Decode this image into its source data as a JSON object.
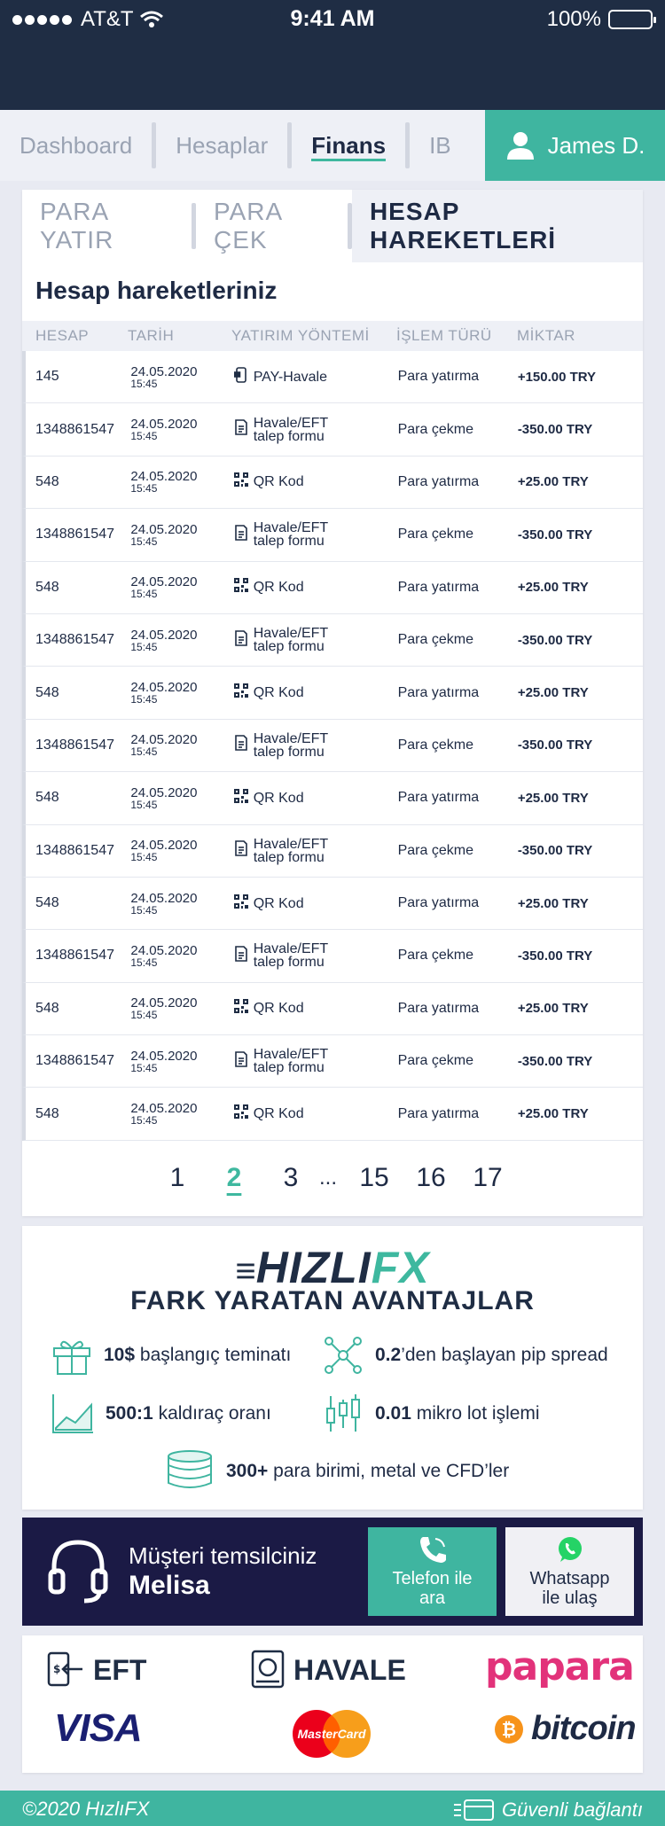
{
  "status": {
    "carrier": "AT&T",
    "time": "9:41 AM",
    "battery": "100%"
  },
  "nav": {
    "tabs": [
      {
        "label": "Dashboard"
      },
      {
        "label": "Hesaplar"
      },
      {
        "label": "Finans",
        "active": true
      },
      {
        "label": "IB"
      }
    ],
    "user": "James D."
  },
  "subtabs": [
    "PARA YATIR",
    "PARA ÇEK",
    "HESAP HAREKETLERİ"
  ],
  "transactions": {
    "title": "Hesap hareketleriniz",
    "headers": [
      "HESAP",
      "TARİH",
      "YATIRIM YÖNTEMİ",
      "İŞLEM TÜRÜ",
      "MİKTAR"
    ],
    "rows": [
      {
        "account": "145",
        "date": "24.05.2020",
        "time": "15:45",
        "method": "PAY-Havale",
        "method2": "",
        "icon": "mobile-pay-icon",
        "type": "Para yatırma",
        "amount": "+150.00 TRY"
      },
      {
        "account": "1348861547",
        "date": "24.05.2020",
        "time": "15:45",
        "method": "Havale/EFT",
        "method2": "talep formu",
        "icon": "form-icon",
        "type": "Para çekme",
        "amount": "-350.00 TRY"
      },
      {
        "account": "548",
        "date": "24.05.2020",
        "time": "15:45",
        "method": "QR Kod",
        "method2": "",
        "icon": "qr-code-icon",
        "type": "Para yatırma",
        "amount": "+25.00 TRY"
      },
      {
        "account": "1348861547",
        "date": "24.05.2020",
        "time": "15:45",
        "method": "Havale/EFT",
        "method2": "talep formu",
        "icon": "form-icon",
        "type": "Para çekme",
        "amount": "-350.00 TRY"
      },
      {
        "account": "548",
        "date": "24.05.2020",
        "time": "15:45",
        "method": "QR Kod",
        "method2": "",
        "icon": "qr-code-icon",
        "type": "Para yatırma",
        "amount": "+25.00 TRY"
      },
      {
        "account": "1348861547",
        "date": "24.05.2020",
        "time": "15:45",
        "method": "Havale/EFT",
        "method2": "talep formu",
        "icon": "form-icon",
        "type": "Para çekme",
        "amount": "-350.00 TRY"
      },
      {
        "account": "548",
        "date": "24.05.2020",
        "time": "15:45",
        "method": "QR Kod",
        "method2": "",
        "icon": "qr-code-icon",
        "type": "Para yatırma",
        "amount": "+25.00 TRY"
      },
      {
        "account": "1348861547",
        "date": "24.05.2020",
        "time": "15:45",
        "method": "Havale/EFT",
        "method2": "talep formu",
        "icon": "form-icon",
        "type": "Para çekme",
        "amount": "-350.00 TRY"
      },
      {
        "account": "548",
        "date": "24.05.2020",
        "time": "15:45",
        "method": "QR Kod",
        "method2": "",
        "icon": "qr-code-icon",
        "type": "Para yatırma",
        "amount": "+25.00 TRY"
      },
      {
        "account": "1348861547",
        "date": "24.05.2020",
        "time": "15:45",
        "method": "Havale/EFT",
        "method2": "talep formu",
        "icon": "form-icon",
        "type": "Para çekme",
        "amount": "-350.00 TRY"
      },
      {
        "account": "548",
        "date": "24.05.2020",
        "time": "15:45",
        "method": "QR Kod",
        "method2": "",
        "icon": "qr-code-icon",
        "type": "Para yatırma",
        "amount": "+25.00 TRY"
      },
      {
        "account": "1348861547",
        "date": "24.05.2020",
        "time": "15:45",
        "method": "Havale/EFT",
        "method2": "talep formu",
        "icon": "form-icon",
        "type": "Para çekme",
        "amount": "-350.00 TRY"
      },
      {
        "account": "548",
        "date": "24.05.2020",
        "time": "15:45",
        "method": "QR Kod",
        "method2": "",
        "icon": "qr-code-icon",
        "type": "Para yatırma",
        "amount": "+25.00 TRY"
      },
      {
        "account": "1348861547",
        "date": "24.05.2020",
        "time": "15:45",
        "method": "Havale/EFT",
        "method2": "talep formu",
        "icon": "form-icon",
        "type": "Para çekme",
        "amount": "-350.00 TRY"
      },
      {
        "account": "548",
        "date": "24.05.2020",
        "time": "15:45",
        "method": "QR Kod",
        "method2": "",
        "icon": "qr-code-icon",
        "type": "Para yatırma",
        "amount": "+25.00 TRY"
      }
    ]
  },
  "pagination": [
    "1",
    "2",
    "3",
    "...",
    "15",
    "16",
    "17"
  ],
  "pagination_active": "2",
  "advantages": {
    "logo_left": "HIZLI",
    "logo_right": "FX",
    "title": "FARK YARATAN AVANTAJLAR",
    "items": [
      {
        "bold": "10$",
        "text": "başlangıç teminatı"
      },
      {
        "bold": "0.2",
        "text": "’den başlayan pip spread"
      },
      {
        "bold": "500:1",
        "text": "kaldıraç oranı"
      },
      {
        "bold": "0.01",
        "text": "mikro lot işlemi"
      },
      {
        "bold": "300+",
        "text": "para birimi, metal ve CFD’ler"
      }
    ]
  },
  "support": {
    "label": "Müşteri temsilciniz",
    "name": "Melisa",
    "call_label_1": "Telefon ile",
    "call_label_2": "ara",
    "wa_label_1": "Whatsapp",
    "wa_label_2": "ile ulaş"
  },
  "payments": [
    "EFT",
    "HAVALE",
    "papara",
    "VISA",
    "MasterCard",
    "bitcoin"
  ],
  "footer": {
    "copyright": "©2020 HızlıFX",
    "secure": "Güvenli bağlantı"
  },
  "colors": {
    "accent": "#3fb5a0",
    "dark": "#1f2d44",
    "support_bg": "#1b1a45",
    "papara": "#e2327a",
    "bitcoin": "#f7931a",
    "visa": "#1a1f71"
  }
}
